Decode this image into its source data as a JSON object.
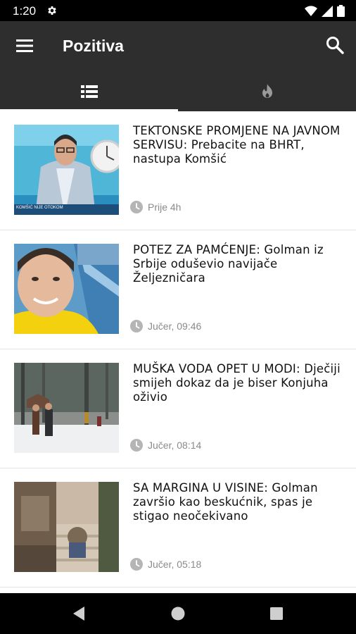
{
  "status_bar": {
    "time": "1:20"
  },
  "app_bar": {
    "title": "Pozitiva"
  },
  "tabs": [
    {
      "icon": "list-icon",
      "selected": true
    },
    {
      "icon": "fire-icon",
      "selected": false
    }
  ],
  "articles": [
    {
      "title": "TEKTONSKE PROMJENE NA JAVNOM SERVISU: Prebacite na BHRT, nastupa Komšić",
      "time": "Prije 4h",
      "thumb_caption": "KOMŠIĆ NIJE OTOKOM"
    },
    {
      "title": "POTEZ ZA PAMĆENJE: Golman iz Srbije oduševio navijače Željezničara",
      "time": "Jučer, 09:46"
    },
    {
      "title": "MUŠKA VODA OPET U MODI: Dječiji smijeh dokaz da je biser Konjuha oživio",
      "time": "Jučer, 08:14"
    },
    {
      "title": "SA MARGINA U VISINE: Golman završio kao beskućnik, spas je stigao neočekivano",
      "time": "Jučer, 05:18"
    }
  ],
  "colors": {
    "app_bar": "#2e2e2e",
    "status_bar": "#000000",
    "meta_text": "#8a8a8a"
  }
}
